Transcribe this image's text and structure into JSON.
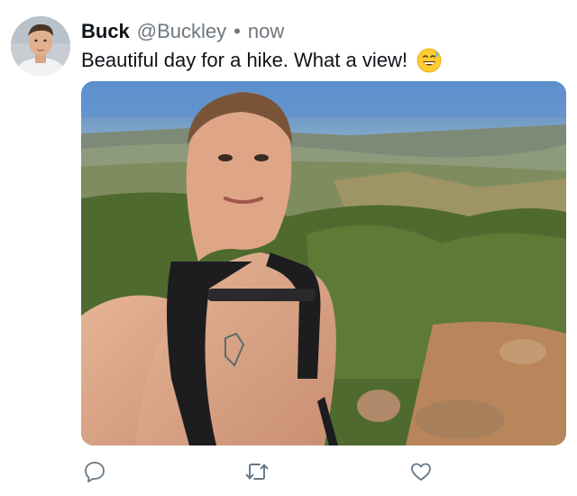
{
  "tweet": {
    "author_name": "Buck",
    "author_handle": "@Buckley",
    "separator": "•",
    "time": "now",
    "text": "Beautiful day for a hike. What a view!",
    "emoji": "grinning-face-with-sweat-emoji"
  },
  "actions": {
    "reply_icon": "reply-icon",
    "retweet_icon": "retweet-icon",
    "like_icon": "heart-icon"
  },
  "colors": {
    "text_primary": "#0f1419",
    "text_secondary": "#6e767d",
    "icon": "#657786"
  }
}
